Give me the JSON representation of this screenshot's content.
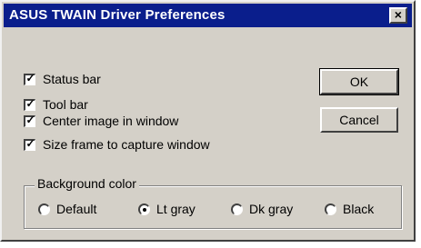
{
  "window": {
    "title": "ASUS TWAIN Driver Preferences",
    "close_label": "×"
  },
  "options": [
    {
      "label": "Status bar",
      "checked": true
    },
    {
      "label": "Tool bar",
      "checked": true
    },
    {
      "label": "Center image in window",
      "checked": true
    },
    {
      "label": "Size frame to capture window",
      "checked": true
    }
  ],
  "buttons": {
    "ok_label": "OK",
    "cancel_label": "Cancel"
  },
  "background_color": {
    "legend": "Background color",
    "choices": [
      {
        "label": "Default",
        "selected": false
      },
      {
        "label": "Lt gray",
        "selected": true
      },
      {
        "label": "Dk gray",
        "selected": false
      },
      {
        "label": "Black",
        "selected": false
      }
    ]
  },
  "check_mark": "✓"
}
